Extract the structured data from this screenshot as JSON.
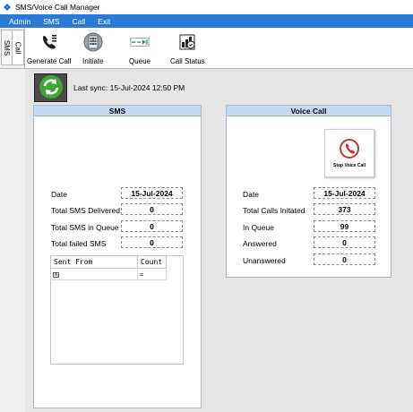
{
  "window": {
    "title": "SMS/Voice Call Manager"
  },
  "menu": [
    "Admin",
    "SMS",
    "Call",
    "Exit"
  ],
  "side_tabs": {
    "sms": "SMS",
    "call": "Call"
  },
  "toolbar": [
    {
      "label": "Generate Call",
      "icon": "generate-call-icon"
    },
    {
      "label": "Initiate",
      "icon": "initiate-icon"
    },
    {
      "label": "Queue",
      "icon": "queue-icon"
    },
    {
      "label": "Call Status",
      "icon": "call-status-icon"
    }
  ],
  "sync": {
    "text": "Last sync: 15-Jul-2024 12:50 PM",
    "icon": "refresh-icon"
  },
  "sms_panel": {
    "title": "SMS",
    "rows": [
      {
        "label": "Date",
        "value": "15-Jul-2024"
      },
      {
        "label": "Total SMS Delivered",
        "value": "0"
      },
      {
        "label": "Total SMS in Queue",
        "value": "0"
      },
      {
        "label": "Total failed SMS",
        "value": "0"
      }
    ],
    "grid": {
      "columns": [
        "Sent From",
        "Count"
      ],
      "rows": [
        {
          "sent_from": "",
          "count": ""
        }
      ]
    }
  },
  "voice_panel": {
    "title": "Voice Call",
    "stop_label": "Stop Voice Call",
    "accent": "#d32f2f",
    "rows": [
      {
        "label": "Date",
        "value": "15-Jul-2024"
      },
      {
        "label": "Total Calls Initated",
        "value": "373"
      },
      {
        "label": "In Queue",
        "value": "99"
      },
      {
        "label": "Answered",
        "value": "0"
      },
      {
        "label": "Unanswered",
        "value": "0"
      }
    ]
  }
}
